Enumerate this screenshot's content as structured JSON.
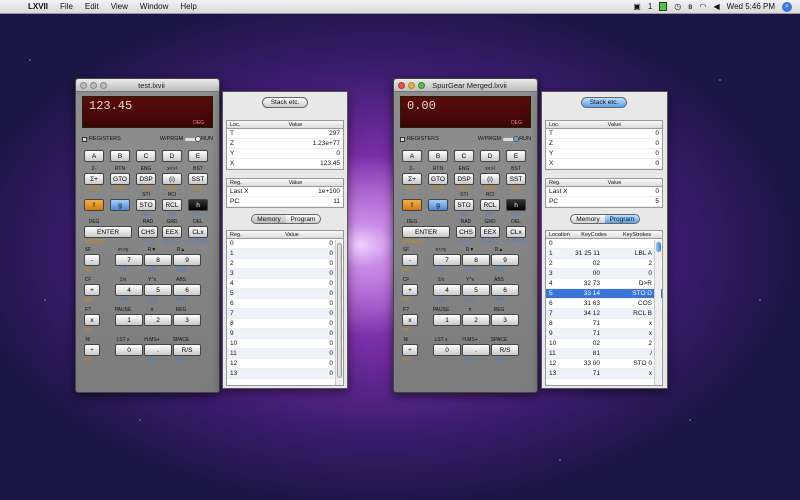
{
  "menubar": {
    "app": "LXVII",
    "items": [
      "File",
      "Edit",
      "View",
      "Window",
      "Help"
    ],
    "clock": "Wed 5:46 PM",
    "indicator": "1"
  },
  "left": {
    "title": "test.lxvii",
    "display": "123.45",
    "mode_flag": "DEG",
    "registers_label": "REGISTERS",
    "prgm_label": "W/PRGM",
    "run_label": "RUN",
    "stack_button": "Stack etc.",
    "stack": {
      "headers": [
        "Loc.",
        "Value"
      ],
      "rows": [
        [
          "T",
          "297"
        ],
        [
          "Z",
          "1.23e+77"
        ],
        [
          "Y",
          "0"
        ],
        [
          "X",
          "123.45"
        ]
      ]
    },
    "lastx": {
      "headers": [
        "Reg.",
        "Value"
      ],
      "rows": [
        [
          "Last X",
          "1e+100"
        ],
        [
          "PC",
          "11"
        ]
      ]
    },
    "tabs": [
      "Memory",
      "Program"
    ],
    "active_tab": "Memory",
    "memory": {
      "headers": [
        "Reg.",
        "Value"
      ],
      "rows": [
        [
          "0",
          "0"
        ],
        [
          "1",
          "0"
        ],
        [
          "2",
          "0"
        ],
        [
          "3",
          "0"
        ],
        [
          "4",
          "0"
        ],
        [
          "5",
          "0"
        ],
        [
          "6",
          "0"
        ],
        [
          "7",
          "0"
        ],
        [
          "8",
          "0"
        ],
        [
          "9",
          "0"
        ],
        [
          "10",
          "0"
        ],
        [
          "11",
          "0"
        ],
        [
          "12",
          "0"
        ],
        [
          "13",
          "0"
        ]
      ]
    }
  },
  "right": {
    "title": "SpurGear Merged.lxvii",
    "display": "0.00",
    "mode_flag": "DEG",
    "registers_label": "REGISTERS",
    "prgm_label": "W/PRGM",
    "run_label": "RUN",
    "stack_button": "Stack etc.",
    "stack": {
      "headers": [
        "Loc.",
        "Value"
      ],
      "rows": [
        [
          "T",
          "0"
        ],
        [
          "Z",
          "0"
        ],
        [
          "Y",
          "0"
        ],
        [
          "X",
          "0"
        ]
      ]
    },
    "lastx": {
      "headers": [
        "Reg.",
        "Value"
      ],
      "rows": [
        [
          "Last X",
          "0"
        ],
        [
          "PC",
          "5"
        ]
      ]
    },
    "tabs": [
      "Memory",
      "Program"
    ],
    "active_tab": "Program",
    "program": {
      "headers": [
        "Location",
        "KeyCodes",
        "KeyStrokes"
      ],
      "rows": [
        [
          "0",
          "",
          ""
        ],
        [
          "1",
          "31 25 11",
          "LBL A"
        ],
        [
          "2",
          "02",
          "2"
        ],
        [
          "3",
          "00",
          "0"
        ],
        [
          "4",
          "32 73",
          "D>R"
        ],
        [
          "5",
          "33 14",
          "STO D"
        ],
        [
          "6",
          "31 63",
          "COS"
        ],
        [
          "7",
          "34 12",
          "RCL B"
        ],
        [
          "8",
          "71",
          "x"
        ],
        [
          "9",
          "71",
          "x"
        ],
        [
          "10",
          "02",
          "2"
        ],
        [
          "11",
          "81",
          "/"
        ],
        [
          "12",
          "33 00",
          "STO 0"
        ],
        [
          "13",
          "71",
          "x"
        ]
      ],
      "selected_row": 5
    }
  },
  "keys": {
    "r1": [
      "A",
      "B",
      "C",
      "D",
      "E"
    ],
    "r2_top": [
      "Σ-",
      "RTN",
      "ENG",
      "x<>I",
      "BST"
    ],
    "r2": [
      "Σ+",
      "GTO",
      "DSP",
      "(i)",
      "SST"
    ],
    "r2_bot": [
      "AVG",
      "GSB",
      "FIX",
      "RND",
      "LBL"
    ],
    "r3_top": [
      "",
      "",
      "STI",
      "RCI",
      ""
    ],
    "r3": [
      "f",
      "g",
      "STO",
      "RCL",
      "h"
    ],
    "r3_bot": [
      "",
      "",
      "SCI",
      "INT",
      "FLN"
    ],
    "r4_top": [
      "DEG",
      "",
      "RAD",
      "GRD",
      "DEL"
    ],
    "r4": [
      "ENTER",
      "CHS",
      "EEX",
      "CLx"
    ],
    "r4_bot": [
      "W/DATA",
      "",
      "P<>S",
      "CL REG",
      "CL PRGM"
    ],
    "r5_top": [
      "SF",
      "x<>y",
      "R▼",
      "R▲"
    ],
    "r5": [
      "-",
      "7",
      "8",
      "9"
    ],
    "r5_bot": [
      "x≤y",
      "LN",
      "LOG",
      "ABS"
    ],
    "r6_top": [
      "CF",
      "1/x",
      "Y^x",
      "ABS"
    ],
    "r6": [
      "+",
      "4",
      "5",
      "6"
    ],
    "r6_bot": [
      "x=0",
      "SIN",
      "COS",
      "TAN"
    ],
    "r7_top": [
      "F?",
      "PAUSE",
      "π",
      "REG"
    ],
    "r7": [
      "x",
      "1",
      "2",
      "3"
    ],
    "r7_bot": [
      "x>0",
      "",
      "",
      ""
    ],
    "r8_top": [
      "N!",
      "LST x",
      "H.MS+",
      "SPACE"
    ],
    "r8": [
      "÷",
      "0",
      ".",
      "R/S"
    ],
    "r8_bot": [
      "x≠0",
      "x",
      "INT",
      "PSE"
    ]
  }
}
